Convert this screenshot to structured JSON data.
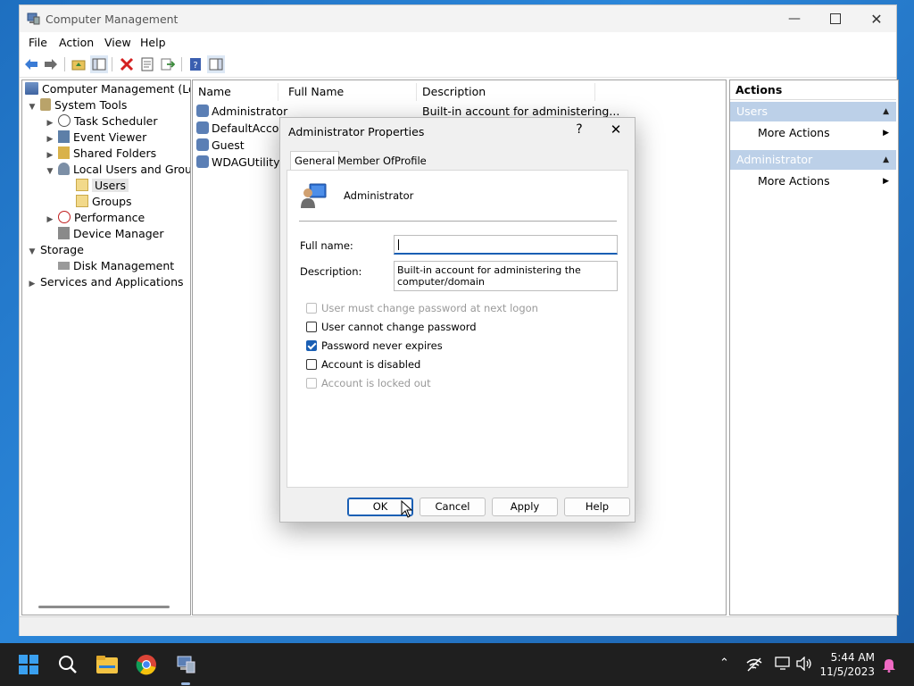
{
  "window": {
    "title": "Computer Management"
  },
  "menu": [
    "File",
    "Action",
    "View",
    "Help"
  ],
  "tree": {
    "root": "Computer Management (Local",
    "system_tools": "System Tools",
    "task_scheduler": "Task Scheduler",
    "event_viewer": "Event Viewer",
    "shared_folders": "Shared Folders",
    "local_users_groups": "Local Users and Groups",
    "users": "Users",
    "groups": "Groups",
    "performance": "Performance",
    "device_manager": "Device Manager",
    "storage": "Storage",
    "disk_management": "Disk Management",
    "services_apps": "Services and Applications"
  },
  "list": {
    "columns": [
      "Name",
      "Full Name",
      "Description"
    ],
    "rows": [
      {
        "name": "Administrator",
        "full_name": "",
        "description": "Built-in account for administering..."
      },
      {
        "name": "DefaultAcco...",
        "full_name": "",
        "description": ""
      },
      {
        "name": "Guest",
        "full_name": "",
        "description": ""
      },
      {
        "name": "WDAGUtility...",
        "full_name": "",
        "description": ""
      }
    ]
  },
  "actions": {
    "header": "Actions",
    "section1": "Users",
    "section1_item": "More Actions",
    "section2": "Administrator",
    "section2_item": "More Actions"
  },
  "dialog": {
    "title": "Administrator Properties",
    "help_glyph": "?",
    "tabs": [
      "General",
      "Member Of",
      "Profile"
    ],
    "user_name": "Administrator",
    "full_name_label": "Full name:",
    "full_name_value": "",
    "description_label": "Description:",
    "description_value": "Built-in account for administering the computer/domain",
    "checkboxes": [
      {
        "label": "User must change password at next logon",
        "checked": false,
        "disabled": true
      },
      {
        "label": "User cannot change password",
        "checked": false,
        "disabled": false
      },
      {
        "label": "Password never expires",
        "checked": true,
        "disabled": false
      },
      {
        "label": "Account is disabled",
        "checked": false,
        "disabled": false
      },
      {
        "label": "Account is locked out",
        "checked": false,
        "disabled": true
      }
    ],
    "buttons": {
      "ok": "OK",
      "cancel": "Cancel",
      "apply": "Apply",
      "help": "Help"
    }
  },
  "taskbar": {
    "time": "5:44 AM",
    "date": "11/5/2023"
  },
  "colors": {
    "accent": "#1a5fb4",
    "action_section": "#bcd0e8"
  }
}
